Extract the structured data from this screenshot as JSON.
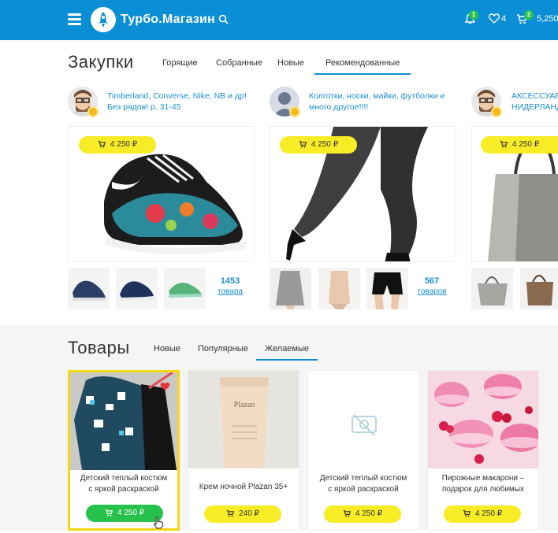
{
  "header": {
    "brand": "Турбо.Магазин",
    "notifications_badge": "1",
    "favorites_count": "4",
    "cart_badge": "2",
    "balance": "5,250"
  },
  "purchases": {
    "title": "Закупки",
    "tabs": [
      "Горящие",
      "Собранные",
      "Новые",
      "Рекомендованные"
    ],
    "active_tab": "Рекомендованные",
    "cards": [
      {
        "user_text_line1": "Timberland, Converse, Nike, NB и др!",
        "user_text_line2": "Без рядов! р. 31-45",
        "price": "4 250 ₽",
        "count": "1453",
        "count_label": "товара"
      },
      {
        "user_text_line1": "Колготки, носки, майки, футболки и",
        "user_text_line2": "много другое!!!!",
        "price": "4 250 ₽",
        "count": "567",
        "count_label": "товаров"
      },
      {
        "user_text_line1": "АКСЕССУАРЫ",
        "user_text_line2": "НИДЕРЛАНД",
        "price": "4 250 ₽"
      }
    ]
  },
  "goods": {
    "title": "Товары",
    "tabs": [
      "Новые",
      "Популярные",
      "Желаемые"
    ],
    "active_tab": "Желаемые",
    "items": [
      {
        "name_line1": "Детский теплый костюм",
        "name_line2": "с яркой раскраской",
        "price": "4 250 ₽",
        "selected": true
      },
      {
        "name_line1": "Крем ночной Plazan 35+",
        "name_line2": "",
        "price": "240 ₽"
      },
      {
        "name_line1": "Детский теплый костюм",
        "name_line2": "с яркой раскраской",
        "price": "4 250 ₽",
        "no_image": true
      },
      {
        "name_line1": "Пирожные макарони –",
        "name_line2": "подарок для любимых",
        "price": "4 250 ₽"
      }
    ]
  },
  "colors": {
    "header_bg": "#0a8ed6",
    "accent_yellow": "#f7ec26",
    "accent_green": "#27c24c",
    "link_blue": "#1a8fd3"
  }
}
